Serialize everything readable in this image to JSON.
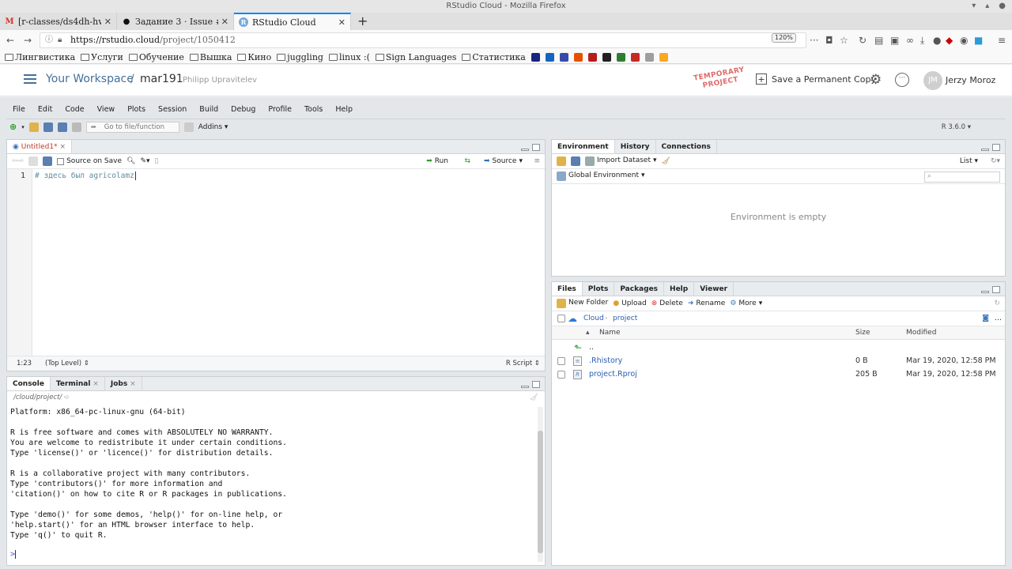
{
  "window": {
    "title": "RStudio Cloud - Mozilla Firefox"
  },
  "browser": {
    "tabs": [
      {
        "label": "[r-classes/ds4dh-hw4v2",
        "icon": "gmail-icon"
      },
      {
        "label": "Задание 3 · Issue #2 · r-cl",
        "icon": "github-icon"
      },
      {
        "label": "RStudio Cloud",
        "icon": "rstudio-icon"
      }
    ],
    "url_host": "https://rstudio.cloud",
    "url_path": "/project/1050412",
    "zoom": "120%",
    "bookmarks": [
      "Лингвистика",
      "Услуги",
      "Обучение",
      "Вышка",
      "Кино",
      "juggling",
      "linux :(",
      "Sign Languages",
      "Статистика"
    ]
  },
  "header": {
    "workspace": "Your Workspace",
    "separator": "/",
    "project": "mar191",
    "owner": "Philipp Upravitelev",
    "temporary_line1": "TEMPORARY",
    "temporary_line2": "PROJECT",
    "save_copy": "Save a Permanent Copy",
    "avatar_initials": "JM",
    "user": "Jerzy Moroz"
  },
  "ide": {
    "menu": [
      "File",
      "Edit",
      "Code",
      "View",
      "Plots",
      "Session",
      "Build",
      "Debug",
      "Profile",
      "Tools",
      "Help"
    ],
    "goto_placeholder": "Go to file/function",
    "addins": "Addins",
    "r_version": "R 3.6.0"
  },
  "editor": {
    "tab": "Untitled1*",
    "source_on_save": "Source on Save",
    "run": "Run",
    "source": "Source",
    "line_number": "1",
    "code": "# здесь был agricolamz",
    "cursor_pos": "1:23",
    "scope": "(Top Level)",
    "file_type": "R Script"
  },
  "console": {
    "tabs": [
      "Console",
      "Terminal",
      "Jobs"
    ],
    "path": "/cloud/project/",
    "lines": "Platform: x86_64-pc-linux-gnu (64-bit)\n\nR is free software and comes with ABSOLUTELY NO WARRANTY.\nYou are welcome to redistribute it under certain conditions.\nType 'license()' or 'licence()' for distribution details.\n\nR is a collaborative project with many contributors.\nType 'contributors()' for more information and\n'citation()' on how to cite R or R packages in publications.\n\nType 'demo()' for some demos, 'help()' for on-line help, or\n'help.start()' for an HTML browser interface to help.\nType 'q()' to quit R.",
    "prompt": ">"
  },
  "environment": {
    "tabs": [
      "Environment",
      "History",
      "Connections"
    ],
    "import": "Import Dataset",
    "list": "List",
    "scope": "Global Environment",
    "empty": "Environment is empty"
  },
  "files": {
    "tabs": [
      "Files",
      "Plots",
      "Packages",
      "Help",
      "Viewer"
    ],
    "new_folder": "New Folder",
    "upload": "Upload",
    "delete": "Delete",
    "rename": "Rename",
    "more": "More",
    "crumb_root": "Cloud",
    "crumb_dir": "project",
    "col_name": "Name",
    "col_size": "Size",
    "col_modified": "Modified",
    "up": "..",
    "rows": [
      {
        "name": ".Rhistory",
        "size": "0 B",
        "modified": "Mar 19, 2020, 12:58 PM"
      },
      {
        "name": "project.Rproj",
        "size": "205 B",
        "modified": "Mar 19, 2020, 12:58 PM"
      }
    ]
  }
}
